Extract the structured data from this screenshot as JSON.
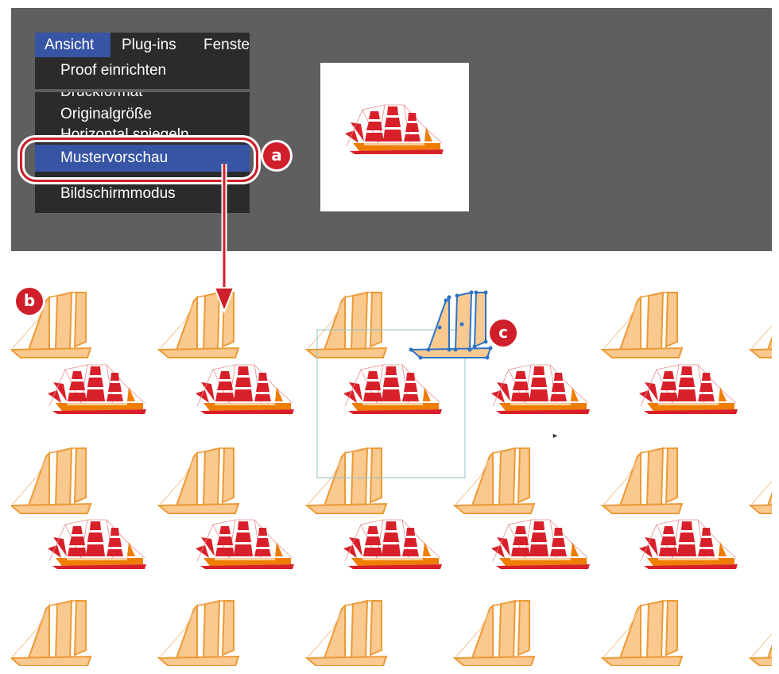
{
  "menubar": {
    "items": [
      {
        "label": "Ansicht",
        "active": true
      },
      {
        "label": "Plug-ins",
        "active": false
      },
      {
        "label": "Fenste",
        "active": false
      }
    ]
  },
  "menu": {
    "items": [
      {
        "label": "Proof einrichten"
      },
      {
        "label": "Druckformat"
      },
      {
        "label": "Originalgröße"
      },
      {
        "label": "Horizontal spiegeln"
      },
      {
        "label": "Mustervorschau",
        "highlighted": true
      },
      {
        "label": "Bildschirmmodus"
      }
    ]
  },
  "callouts": {
    "a": "a",
    "b": "b",
    "c": "c"
  },
  "icons": [
    "sailing-ship-icon",
    "schooner-icon",
    "mouse-cursor-icon",
    "arrow-down-icon"
  ],
  "colors": {
    "panel": "#5f5f5f",
    "menu": "#2b2b2b",
    "highlight": "#3754a5",
    "callout": "#cf1f2a",
    "ship_orange": "#ef7d00",
    "ship_red": "#d8202a",
    "schooner_fill": "#f9c98f",
    "schooner_stroke": "#ec9a37",
    "selection": "#2e72c8",
    "tile_frame": "#8fc4c7"
  }
}
